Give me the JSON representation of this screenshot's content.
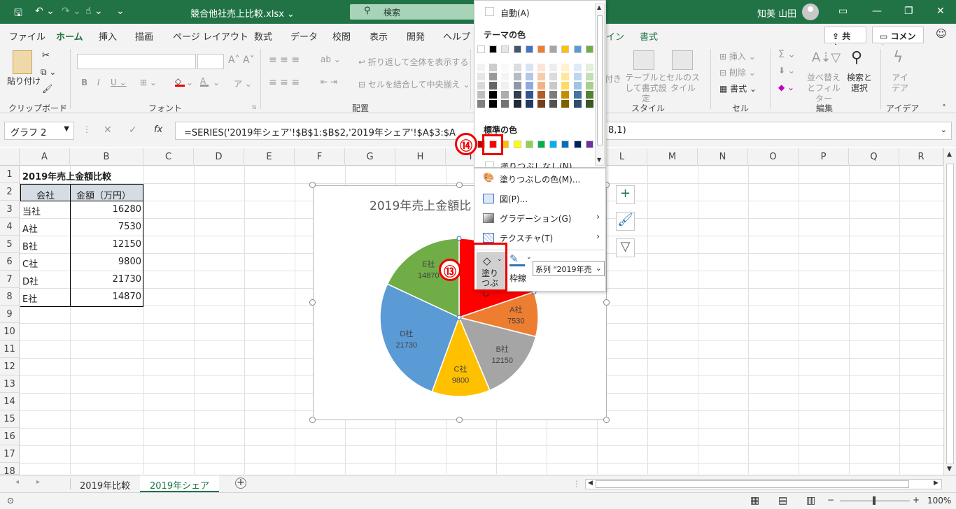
{
  "titlebar": {
    "doc_title": "競合他社売上比較.xlsx ⌄",
    "search_placeholder": "検索",
    "user_name": "知美 山田"
  },
  "ribbon_tabs": [
    "ファイル",
    "ホーム",
    "挿入",
    "描画",
    "ページ レイアウト",
    "数式",
    "データ",
    "校閲",
    "表示",
    "開発",
    "ヘルプ",
    "イン",
    "書式"
  ],
  "share_label": "共有",
  "comment_label": "コメント",
  "ribbon": {
    "paste": "貼り付け",
    "clipboard": "クリップボード",
    "font": "フォント",
    "wrap_text": "折り返して全体を表示する",
    "merge_center": "セルを結合して中央揃え",
    "alignment": "配置",
    "table_format": "テーブルとして書式設定",
    "cell_style": "セルのスタイル",
    "style": "スタイル",
    "insert": "挿入",
    "delete": "削除",
    "format": "書式",
    "cells": "セル",
    "sort_filter": "並べ替えとフィルター",
    "find_select": "検索と選択",
    "editing": "編集",
    "ideas": "アイデア",
    "ideas_group": "アイデア",
    "cond_partial": "付き"
  },
  "formula_bar": {
    "name_box": "グラフ 2",
    "formula": "=SERIES('2019年シェア'!$B$1:$B$2,'2019年シェア'!$A$3:$A",
    "formula_tail": "8,1)"
  },
  "columns": [
    "A",
    "B",
    "C",
    "D",
    "E",
    "F",
    "G",
    "H",
    "I",
    "J",
    "K",
    "L",
    "M",
    "N",
    "O",
    "P",
    "Q",
    "R"
  ],
  "rows": [
    "1",
    "2",
    "3",
    "4",
    "5",
    "6",
    "7",
    "8",
    "9",
    "10",
    "11",
    "12",
    "13",
    "14",
    "15",
    "16",
    "17",
    "18"
  ],
  "sheet": {
    "title": "2019年売上金額比較",
    "header_company": "会社",
    "header_amount": "金額（万円）",
    "data": [
      {
        "company": "当社",
        "amount": "16280"
      },
      {
        "company": "A社",
        "amount": "7530"
      },
      {
        "company": "B社",
        "amount": "12150"
      },
      {
        "company": "C社",
        "amount": "9800"
      },
      {
        "company": "D社",
        "amount": "21730"
      },
      {
        "company": "E社",
        "amount": "14870"
      }
    ]
  },
  "chart_data": {
    "type": "pie",
    "title": "2019年売上金額比",
    "categories": [
      "当社",
      "A社",
      "B社",
      "C社",
      "D社",
      "E社"
    ],
    "values": [
      16280,
      7530,
      12150,
      9800,
      21730,
      14870
    ],
    "colors": [
      "#ff0000",
      "#ed7d31",
      "#a5a5a5",
      "#ffc000",
      "#5b9bd5",
      "#70ad47"
    ]
  },
  "color_menu": {
    "auto": "自動(A)",
    "theme_colors": "テーマの色",
    "standard_colors": "標準の色",
    "no_fill_partial": "塗りつぶしなし(N)",
    "theme_row": [
      "#ffffff",
      "#000000",
      "#e7e6e6",
      "#44546a",
      "#4472c4",
      "#ed7d31",
      "#a5a5a5",
      "#ffc000",
      "#5b9bd5",
      "#70ad47"
    ],
    "standard_row": [
      "#c00000",
      "#ff0000",
      "#ffc000",
      "#ffff00",
      "#92d050",
      "#00b050",
      "#00b0f0",
      "#0070c0",
      "#002060",
      "#7030a0"
    ]
  },
  "fill_menu": {
    "more_colors": "塗りつぶしの色(M)...",
    "picture": "図(P)...",
    "gradient": "グラデーション(G)",
    "texture": "テクスチャ(T)"
  },
  "mini_toolbar": {
    "fill": "塗りつぶし",
    "outline": "枠線",
    "series_select": "系列 \"2019年売"
  },
  "annotations": {
    "step13": "⑬",
    "step14": "⑭"
  },
  "sheet_tabs": [
    "2019年比較",
    "2019年シェア"
  ],
  "status": {
    "zoom": "100%"
  }
}
